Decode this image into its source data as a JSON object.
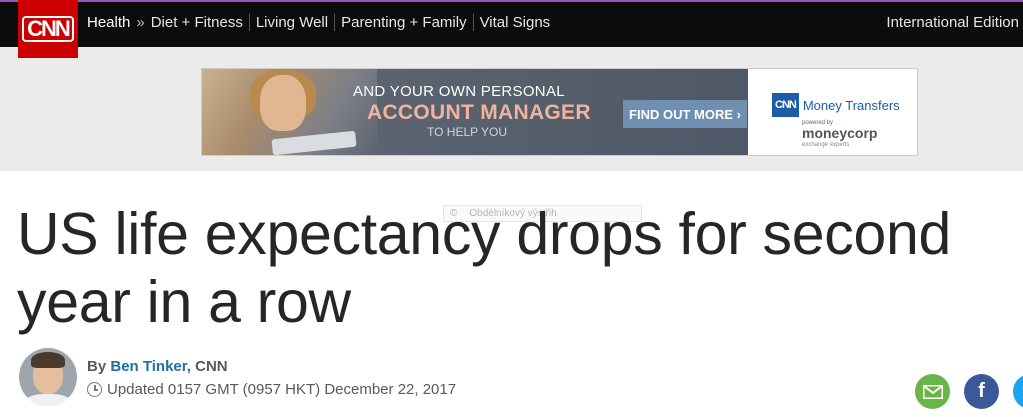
{
  "brand": {
    "logo_text": "CNN",
    "accent_color": "#cc0000"
  },
  "nav": {
    "section": "Health",
    "separator": "»",
    "items": [
      "Diet + Fitness",
      "Living Well",
      "Parenting + Family",
      "Vital Signs"
    ],
    "edition": "International Edition"
  },
  "ad": {
    "line1": "AND YOUR OWN PERSONAL",
    "line2": "ACCOUNT MANAGER",
    "line3": "TO HELP YOU",
    "cta": "FIND OUT MORE ›",
    "brand_logo": "CNN",
    "brand_name": "Money Transfers",
    "powered_by": "powered by",
    "partner": "moneycorp",
    "partner_tagline": "exchange experts",
    "tag_icon": "©",
    "tag_text": "Obdélníkový výstřih"
  },
  "article": {
    "headline": "US life expectancy drops for second year in a row",
    "by_label": "By",
    "author": "Ben Tinker",
    "org": ", CNN",
    "updated": "Updated 0157 GMT (0957 HKT) December 22, 2017"
  },
  "share": {
    "email_icon": "email-icon",
    "facebook_icon": "facebook-icon",
    "twitter_icon": "twitter-icon",
    "facebook_glyph": "f"
  }
}
